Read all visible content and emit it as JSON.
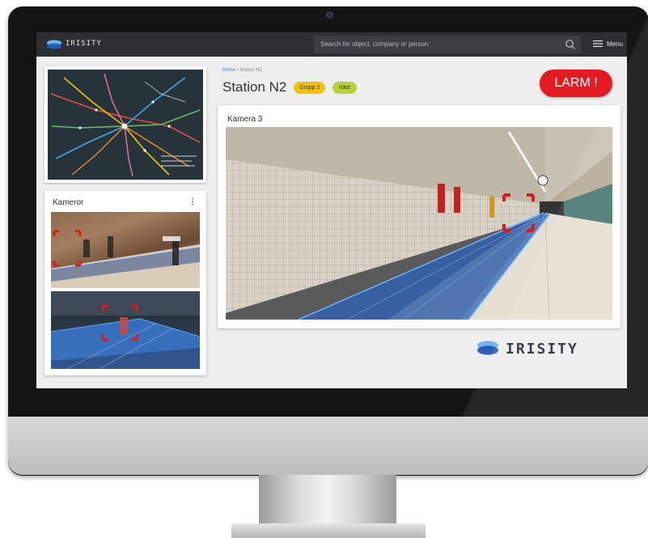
{
  "navbar": {
    "brand": "IRISITY",
    "search_placeholder": "Search for object, company or person",
    "menu_label": "Menu"
  },
  "breadcrumb": {
    "home": "Home",
    "separator": " / ",
    "current": "Station N2"
  },
  "station": {
    "title": "Station N2",
    "tags": [
      "Grupp 2",
      "Väst"
    ]
  },
  "alarm_button": "LARM !",
  "cameras_panel": {
    "title": "Kameror",
    "more": "⋮"
  },
  "main_camera": {
    "title": "Kamera 3"
  },
  "footer": {
    "brand": "IRISITY"
  },
  "colors": {
    "alarm": "#e31b23",
    "tag_grupp": "#f2c10f",
    "tag_vast": "#b5d334",
    "link": "#1e88e5",
    "navbar": "#2e2f33",
    "detection": "#e01a1a",
    "zone": "#1e64c8"
  },
  "icons": {
    "logo": "irisity-logo-icon",
    "search": "search-icon",
    "menu": "hamburger-menu-icon"
  }
}
